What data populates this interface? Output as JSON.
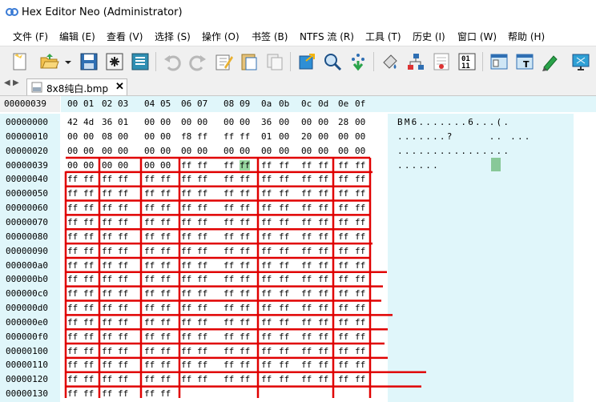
{
  "window": {
    "title": "Hex Editor Neo (Administrator)"
  },
  "menu": [
    "文件 (F)",
    "编辑 (E)",
    "查看 (V)",
    "选择 (S)",
    "操作 (O)",
    "书签 (B)",
    "NTFS 流 (R)",
    "工具 (T)",
    "历史 (I)",
    "窗口 (W)",
    "帮助 (H)"
  ],
  "toolbar_icons": [
    "new-file-icon",
    "open-folder-icon",
    "dropdown-arrow-icon",
    "save-icon",
    "save-all-icon",
    "save-as-icon",
    "undo-icon",
    "redo-icon",
    "edit-icon",
    "paste-icon",
    "copy-icon",
    "export-icon",
    "find-icon",
    "goto-icon",
    "fill-icon",
    "structure-icon",
    "ascii-icon",
    "number-01-icon",
    "window-layout-icon",
    "text-pane-icon",
    "highlight-icon",
    "screen-icon"
  ],
  "tab": {
    "label": "8x8纯白.bmp",
    "close": "✕"
  },
  "nav": {
    "left": "◀",
    "right": "▶"
  },
  "header": {
    "offset": "00000039",
    "cols": [
      "00",
      "01",
      "02",
      "03",
      "04",
      "05",
      "06",
      "07",
      "08",
      "09",
      "0a",
      "0b",
      "0c",
      "0d",
      "0e",
      "0f"
    ]
  },
  "rows": [
    {
      "offset": "00000000",
      "bytes": [
        "42",
        "4d",
        "36",
        "01",
        "00",
        "00",
        "00",
        "00",
        "00",
        "00",
        "36",
        "00",
        "00",
        "00",
        "28",
        "00"
      ],
      "text": "BM6.......6...(."
    },
    {
      "offset": "00000010",
      "bytes": [
        "00",
        "00",
        "08",
        "00",
        "00",
        "00",
        "f8",
        "ff",
        "ff",
        "ff",
        "01",
        "00",
        "20",
        "00",
        "00",
        "00"
      ],
      "text": ".......?     .. ..."
    },
    {
      "offset": "00000020",
      "bytes": [
        "00",
        "00",
        "00",
        "00",
        "00",
        "00",
        "00",
        "00",
        "00",
        "00",
        "00",
        "00",
        "00",
        "00",
        "00",
        "00"
      ],
      "text": "................"
    },
    {
      "offset": "00000039",
      "bytes": [
        "00",
        "00",
        "00",
        "00",
        "00",
        "00",
        "ff",
        "ff",
        "ff",
        "ff",
        "ff",
        "ff",
        "ff",
        "ff",
        "ff",
        "ff"
      ],
      "text": "......"
    },
    {
      "offset": "00000040",
      "bytes": [
        "ff",
        "ff",
        "ff",
        "ff",
        "ff",
        "ff",
        "ff",
        "ff",
        "ff",
        "ff",
        "ff",
        "ff",
        "ff",
        "ff",
        "ff",
        "ff"
      ],
      "text": ""
    },
    {
      "offset": "00000050",
      "bytes": [
        "ff",
        "ff",
        "ff",
        "ff",
        "ff",
        "ff",
        "ff",
        "ff",
        "ff",
        "ff",
        "ff",
        "ff",
        "ff",
        "ff",
        "ff",
        "ff"
      ],
      "text": ""
    },
    {
      "offset": "00000060",
      "bytes": [
        "ff",
        "ff",
        "ff",
        "ff",
        "ff",
        "ff",
        "ff",
        "ff",
        "ff",
        "ff",
        "ff",
        "ff",
        "ff",
        "ff",
        "ff",
        "ff"
      ],
      "text": ""
    },
    {
      "offset": "00000070",
      "bytes": [
        "ff",
        "ff",
        "ff",
        "ff",
        "ff",
        "ff",
        "ff",
        "ff",
        "ff",
        "ff",
        "ff",
        "ff",
        "ff",
        "ff",
        "ff",
        "ff"
      ],
      "text": ""
    },
    {
      "offset": "00000080",
      "bytes": [
        "ff",
        "ff",
        "ff",
        "ff",
        "ff",
        "ff",
        "ff",
        "ff",
        "ff",
        "ff",
        "ff",
        "ff",
        "ff",
        "ff",
        "ff",
        "ff"
      ],
      "text": ""
    },
    {
      "offset": "00000090",
      "bytes": [
        "ff",
        "ff",
        "ff",
        "ff",
        "ff",
        "ff",
        "ff",
        "ff",
        "ff",
        "ff",
        "ff",
        "ff",
        "ff",
        "ff",
        "ff",
        "ff"
      ],
      "text": ""
    },
    {
      "offset": "000000a0",
      "bytes": [
        "ff",
        "ff",
        "ff",
        "ff",
        "ff",
        "ff",
        "ff",
        "ff",
        "ff",
        "ff",
        "ff",
        "ff",
        "ff",
        "ff",
        "ff",
        "ff"
      ],
      "text": ""
    },
    {
      "offset": "000000b0",
      "bytes": [
        "ff",
        "ff",
        "ff",
        "ff",
        "ff",
        "ff",
        "ff",
        "ff",
        "ff",
        "ff",
        "ff",
        "ff",
        "ff",
        "ff",
        "ff",
        "ff"
      ],
      "text": ""
    },
    {
      "offset": "000000c0",
      "bytes": [
        "ff",
        "ff",
        "ff",
        "ff",
        "ff",
        "ff",
        "ff",
        "ff",
        "ff",
        "ff",
        "ff",
        "ff",
        "ff",
        "ff",
        "ff",
        "ff"
      ],
      "text": ""
    },
    {
      "offset": "000000d0",
      "bytes": [
        "ff",
        "ff",
        "ff",
        "ff",
        "ff",
        "ff",
        "ff",
        "ff",
        "ff",
        "ff",
        "ff",
        "ff",
        "ff",
        "ff",
        "ff",
        "ff"
      ],
      "text": ""
    },
    {
      "offset": "000000e0",
      "bytes": [
        "ff",
        "ff",
        "ff",
        "ff",
        "ff",
        "ff",
        "ff",
        "ff",
        "ff",
        "ff",
        "ff",
        "ff",
        "ff",
        "ff",
        "ff",
        "ff"
      ],
      "text": ""
    },
    {
      "offset": "000000f0",
      "bytes": [
        "ff",
        "ff",
        "ff",
        "ff",
        "ff",
        "ff",
        "ff",
        "ff",
        "ff",
        "ff",
        "ff",
        "ff",
        "ff",
        "ff",
        "ff",
        "ff"
      ],
      "text": ""
    },
    {
      "offset": "00000100",
      "bytes": [
        "ff",
        "ff",
        "ff",
        "ff",
        "ff",
        "ff",
        "ff",
        "ff",
        "ff",
        "ff",
        "ff",
        "ff",
        "ff",
        "ff",
        "ff",
        "ff"
      ],
      "text": ""
    },
    {
      "offset": "00000110",
      "bytes": [
        "ff",
        "ff",
        "ff",
        "ff",
        "ff",
        "ff",
        "ff",
        "ff",
        "ff",
        "ff",
        "ff",
        "ff",
        "ff",
        "ff",
        "ff",
        "ff"
      ],
      "text": ""
    },
    {
      "offset": "00000120",
      "bytes": [
        "ff",
        "ff",
        "ff",
        "ff",
        "ff",
        "ff",
        "ff",
        "ff",
        "ff",
        "ff",
        "ff",
        "ff",
        "ff",
        "ff",
        "ff",
        "ff"
      ],
      "text": ""
    },
    {
      "offset": "00000130",
      "bytes": [
        "ff",
        "ff",
        "ff",
        "ff",
        "ff",
        "ff",
        "",
        "",
        "",
        "",
        "",
        "",
        "",
        "",
        "",
        ""
      ],
      "text": ""
    }
  ],
  "selected": {
    "row": 3,
    "col": 9
  },
  "colors": {
    "accent_bg": "#e0f6fa",
    "annotation": "#e00000",
    "selection": "#98d8a0"
  }
}
